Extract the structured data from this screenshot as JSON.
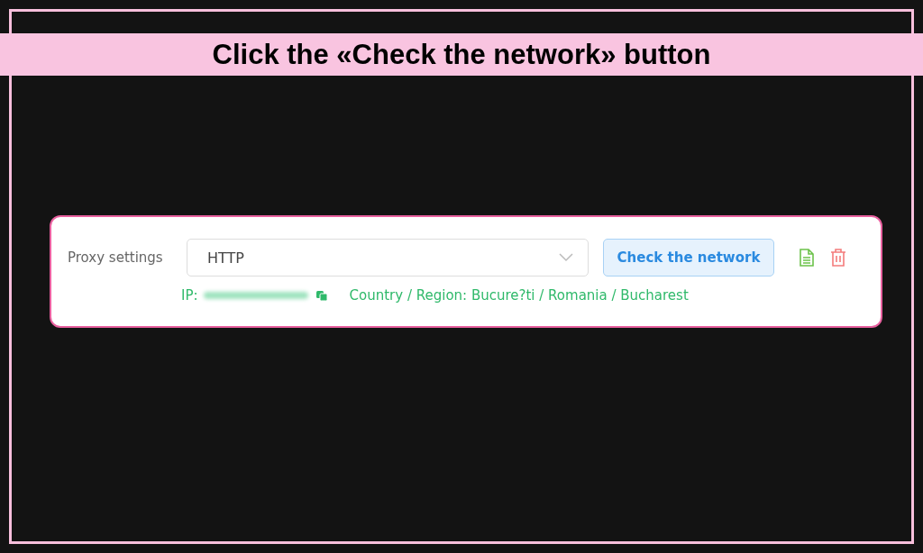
{
  "banner": {
    "title": "Click the «Check the network» button"
  },
  "proxy_card": {
    "label": "Proxy settings",
    "protocol_select": {
      "value": "HTTP"
    },
    "check_button": {
      "label": "Check the network"
    },
    "ip_label": "IP:",
    "location": "Country / Region: Bucure?ti / Romania / Bucharest"
  }
}
